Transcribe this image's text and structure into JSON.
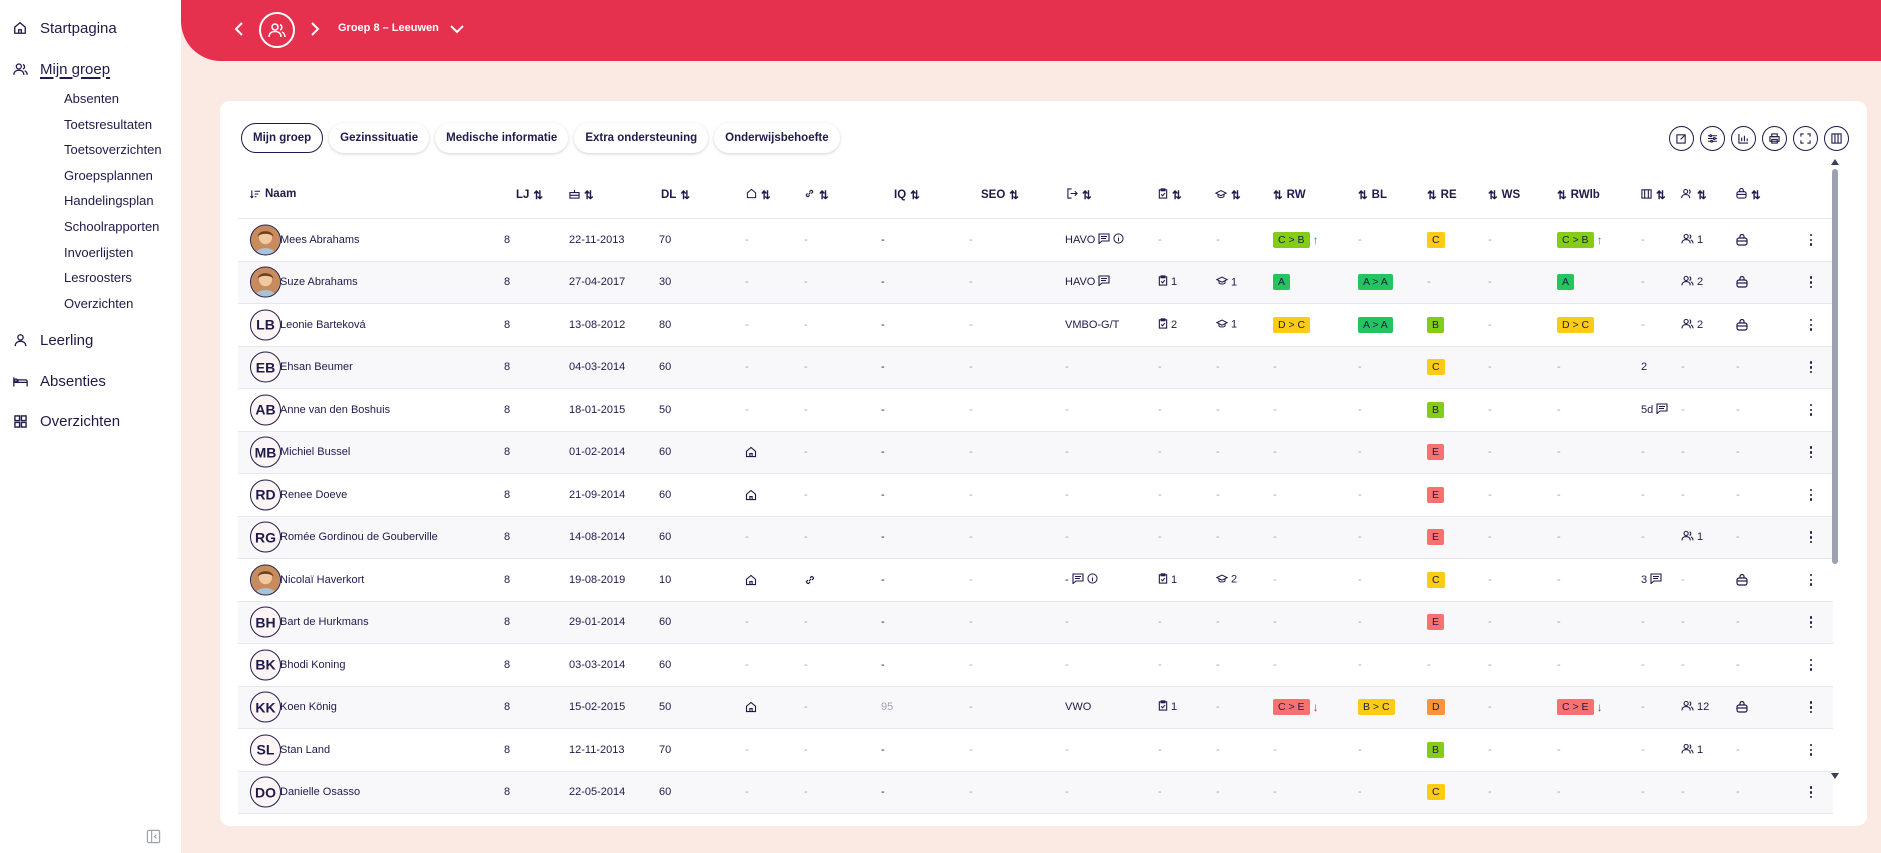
{
  "sidebar": {
    "nav": [
      {
        "label": "Startpagina",
        "icon": "home-icon"
      },
      {
        "label": "Mijn groep",
        "icon": "users-icon",
        "active": true
      },
      {
        "label": "Leerling",
        "icon": "user-icon"
      },
      {
        "label": "Absenties",
        "icon": "bed-icon"
      },
      {
        "label": "Overzichten",
        "icon": "grid-icon"
      }
    ],
    "sub": [
      "Absenten",
      "Toetsresultaten",
      "Toetsoverzichten",
      "Groepsplannen",
      "Handelingsplan",
      "Schoolrapporten",
      "Invoerlijsten",
      "Lesroosters",
      "Overzichten"
    ]
  },
  "header": {
    "group_title": "Groep 8 – Leeuwen"
  },
  "tabs": [
    "Mijn groep",
    "Gezinssituatie",
    "Medische informatie",
    "Extra ondersteuning",
    "Onderwijsbehoefte"
  ],
  "toolbar": [
    "edit-icon",
    "sliders-icon",
    "chart-icon",
    "print-icon",
    "fullscreen-icon",
    "columns-icon"
  ],
  "columns": {
    "naam": "Naam",
    "lj": "LJ",
    "dl": "DL",
    "iq": "IQ",
    "seo": "SEO",
    "rw": "RW",
    "bl": "BL",
    "re": "RE",
    "ws": "WS",
    "rwlb": "RWlb"
  },
  "colors": {
    "primary": "#e5304e",
    "text": "#1e1b4b",
    "bg": "#fbe9e4"
  },
  "rows": [
    {
      "initials": "",
      "photo": true,
      "name": "Mees Abrahams",
      "lj": "8",
      "date": "22-11-2013",
      "dl": "70",
      "home": false,
      "link": false,
      "iq": "-",
      "seo": "-",
      "uit": "HAVO",
      "uit_icons": true,
      "uit_info": true,
      "clip": "",
      "hat": "",
      "rw": "C > B",
      "rw_color": "lime",
      "rw_arrow": "up",
      "bl": "",
      "bl_color": "",
      "re": "C",
      "re_color": "yellow",
      "ws": "-",
      "rwlb": "C > B",
      "rwlb_color": "lime",
      "rwlb_arrow": "up",
      "bldg": "",
      "grp": "1",
      "bag": true
    },
    {
      "initials": "",
      "photo": true,
      "name": "Suze Abrahams",
      "lj": "8",
      "date": "27-04-2017",
      "dl": "30",
      "home": false,
      "link": false,
      "iq": "-",
      "seo": "-",
      "uit": "HAVO",
      "uit_icons": true,
      "uit_info": false,
      "clip": "1",
      "hat": "1",
      "rw": "A",
      "rw_color": "green",
      "rw_arrow": "",
      "bl": "A > A",
      "bl_color": "green",
      "re": "",
      "re_color": "",
      "ws": "-",
      "rwlb": "A",
      "rwlb_color": "green",
      "rwlb_arrow": "",
      "bldg": "",
      "grp": "2",
      "bag": true
    },
    {
      "initials": "LB",
      "photo": false,
      "name": "Leonie Barteková",
      "lj": "8",
      "date": "13-08-2012",
      "dl": "80",
      "home": false,
      "link": false,
      "iq": "-",
      "seo": "-",
      "uit": "VMBO-G/T",
      "uit_icons": false,
      "uit_info": false,
      "clip": "2",
      "hat": "1",
      "rw": "D > C",
      "rw_color": "yellow",
      "rw_arrow": "",
      "bl": "A > A",
      "bl_color": "green",
      "re": "B",
      "re_color": "lime",
      "ws": "-",
      "rwlb": "D > C",
      "rwlb_color": "yellow",
      "rwlb_arrow": "",
      "bldg": "",
      "grp": "2",
      "bag": true
    },
    {
      "initials": "EB",
      "photo": false,
      "name": "Ehsan Beumer",
      "lj": "8",
      "date": "04-03-2014",
      "dl": "60",
      "home": false,
      "link": false,
      "iq": "-",
      "seo": "-",
      "uit": "",
      "uit_icons": false,
      "uit_info": false,
      "clip": "",
      "hat": "",
      "rw": "",
      "rw_color": "",
      "rw_arrow": "",
      "bl": "",
      "bl_color": "",
      "re": "C",
      "re_color": "yellow",
      "ws": "-",
      "rwlb": "",
      "rwlb_color": "",
      "rwlb_arrow": "",
      "bldg": "2",
      "grp": "",
      "bag": false
    },
    {
      "initials": "AB",
      "photo": false,
      "name": "Anne van den Boshuis",
      "lj": "8",
      "date": "18-01-2015",
      "dl": "50",
      "home": false,
      "link": false,
      "iq": "-",
      "seo": "-",
      "uit": "",
      "uit_icons": false,
      "uit_info": false,
      "clip": "",
      "hat": "",
      "rw": "",
      "rw_color": "",
      "rw_arrow": "",
      "bl": "",
      "bl_color": "",
      "re": "B",
      "re_color": "lime",
      "ws": "-",
      "rwlb": "",
      "rwlb_color": "",
      "rwlb_arrow": "",
      "bldg": "5d",
      "bldg_note": true,
      "grp": "",
      "bag": false
    },
    {
      "initials": "MB",
      "photo": false,
      "name": "Michiel Bussel",
      "lj": "8",
      "date": "01-02-2014",
      "dl": "60",
      "home": true,
      "link": false,
      "iq": "-",
      "seo": "-",
      "uit": "",
      "uit_icons": false,
      "uit_info": false,
      "clip": "",
      "hat": "",
      "rw": "",
      "rw_color": "",
      "rw_arrow": "",
      "bl": "",
      "bl_color": "",
      "re": "E",
      "re_color": "red",
      "ws": "-",
      "rwlb": "",
      "rwlb_color": "",
      "rwlb_arrow": "",
      "bldg": "",
      "grp": "",
      "bag": false
    },
    {
      "initials": "RD",
      "photo": false,
      "name": "Renee Doeve",
      "lj": "8",
      "date": "21-09-2014",
      "dl": "60",
      "home": true,
      "link": false,
      "iq": "-",
      "seo": "-",
      "uit": "",
      "uit_icons": false,
      "uit_info": false,
      "clip": "",
      "hat": "",
      "rw": "",
      "rw_color": "",
      "rw_arrow": "",
      "bl": "",
      "bl_color": "",
      "re": "E",
      "re_color": "red",
      "ws": "-",
      "rwlb": "",
      "rwlb_color": "",
      "rwlb_arrow": "",
      "bldg": "",
      "grp": "",
      "bag": false
    },
    {
      "initials": "RG",
      "photo": false,
      "name": "Romée Gordinou de Gouberville",
      "lj": "8",
      "date": "14-08-2014",
      "dl": "60",
      "home": false,
      "link": false,
      "iq": "-",
      "seo": "-",
      "uit": "",
      "uit_icons": false,
      "uit_info": false,
      "clip": "",
      "hat": "",
      "rw": "",
      "rw_color": "",
      "rw_arrow": "",
      "bl": "",
      "bl_color": "",
      "re": "E",
      "re_color": "red",
      "ws": "-",
      "rwlb": "",
      "rwlb_color": "",
      "rwlb_arrow": "",
      "bldg": "",
      "grp": "1",
      "bag": false
    },
    {
      "initials": "",
      "photo": true,
      "name": "Nicolaï Haverkort",
      "lj": "8",
      "date": "19-08-2019",
      "dl": "10",
      "home": true,
      "link": true,
      "iq": "-",
      "seo": "-",
      "uit": "-",
      "uit_icons": true,
      "uit_info": true,
      "clip": "1",
      "hat": "2",
      "rw": "",
      "rw_color": "",
      "rw_arrow": "",
      "bl": "",
      "bl_color": "",
      "re": "C",
      "re_color": "yellow",
      "ws": "-",
      "rwlb": "",
      "rwlb_color": "",
      "rwlb_arrow": "",
      "bldg": "3",
      "bldg_note": true,
      "grp": "",
      "bag": true
    },
    {
      "initials": "BH",
      "photo": false,
      "name": "Bart de Hurkmans",
      "lj": "8",
      "date": "29-01-2014",
      "dl": "60",
      "home": false,
      "link": false,
      "iq": "-",
      "seo": "-",
      "uit": "",
      "uit_icons": false,
      "uit_info": false,
      "clip": "",
      "hat": "",
      "rw": "",
      "rw_color": "",
      "rw_arrow": "",
      "bl": "",
      "bl_color": "",
      "re": "E",
      "re_color": "red",
      "ws": "-",
      "rwlb": "",
      "rwlb_color": "",
      "rwlb_arrow": "",
      "bldg": "",
      "grp": "",
      "bag": false
    },
    {
      "initials": "BK",
      "photo": false,
      "name": "Bhodi Koning",
      "lj": "8",
      "date": "03-03-2014",
      "dl": "60",
      "home": false,
      "link": false,
      "iq": "-",
      "seo": "-",
      "uit": "",
      "uit_icons": false,
      "uit_info": false,
      "clip": "",
      "hat": "",
      "rw": "",
      "rw_color": "",
      "rw_arrow": "",
      "bl": "",
      "bl_color": "",
      "re": "",
      "re_color": "",
      "ws": "-",
      "rwlb": "",
      "rwlb_color": "",
      "rwlb_arrow": "",
      "bldg": "",
      "grp": "",
      "bag": false
    },
    {
      "initials": "KK",
      "photo": false,
      "name": "Koen König",
      "lj": "8",
      "date": "15-02-2015",
      "dl": "50",
      "home": true,
      "link": false,
      "iq": "95",
      "seo": "-",
      "uit": "VWO",
      "uit_icons": false,
      "uit_info": false,
      "clip": "1",
      "hat": "",
      "rw": "C > E",
      "rw_color": "red",
      "rw_arrow": "down",
      "bl": "B > C",
      "bl_color": "yellow",
      "re": "D",
      "re_color": "orange",
      "ws": "-",
      "rwlb": "C > E",
      "rwlb_color": "red",
      "rwlb_arrow": "down",
      "bldg": "",
      "grp": "12",
      "bag": true
    },
    {
      "initials": "SL",
      "photo": false,
      "name": "Stan Land",
      "lj": "8",
      "date": "12-11-2013",
      "dl": "70",
      "home": false,
      "link": false,
      "iq": "-",
      "seo": "-",
      "uit": "",
      "uit_icons": false,
      "uit_info": false,
      "clip": "",
      "hat": "",
      "rw": "",
      "rw_color": "",
      "rw_arrow": "",
      "bl": "",
      "bl_color": "",
      "re": "B",
      "re_color": "lime",
      "ws": "-",
      "rwlb": "",
      "rwlb_color": "",
      "rwlb_arrow": "",
      "bldg": "",
      "grp": "1",
      "bag": false
    },
    {
      "initials": "DO",
      "photo": false,
      "name": "Danielle Osasso",
      "lj": "8",
      "date": "22-05-2014",
      "dl": "60",
      "home": false,
      "link": false,
      "iq": "-",
      "seo": "-",
      "uit": "",
      "uit_icons": false,
      "uit_info": false,
      "clip": "",
      "hat": "",
      "rw": "",
      "rw_color": "",
      "rw_arrow": "",
      "bl": "",
      "bl_color": "",
      "re": "C",
      "re_color": "yellow",
      "ws": "-",
      "rwlb": "",
      "rwlb_color": "",
      "rwlb_arrow": "",
      "bldg": "",
      "grp": "",
      "bag": false
    }
  ]
}
